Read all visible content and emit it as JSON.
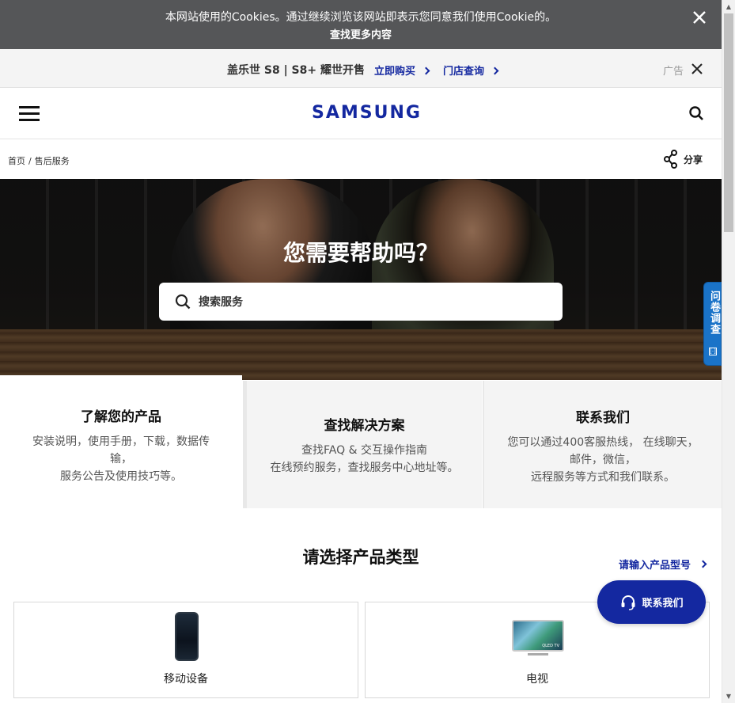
{
  "cookie": {
    "message": "本网站使用的Cookies。通过继续浏览该网站即表示您同意我们使用Cookie的。",
    "more": "查找更多内容"
  },
  "promo": {
    "text": "盖乐世 S8 | S8+ 耀世开售",
    "buy": "立即购买",
    "store": "门店查询",
    "ad": "广告"
  },
  "header": {
    "logo": "SAMSUNG"
  },
  "breadcrumb": {
    "home": "首页",
    "current": "售后服务"
  },
  "share": {
    "label": "分享"
  },
  "hero": {
    "title": "您需要帮助吗？",
    "search_placeholder": "搜索服务"
  },
  "tabs": [
    {
      "title": "了解您的产品",
      "desc": "安装说明，使用手册，下载，数据传输，\n服务公告及使用技巧等。"
    },
    {
      "title": "查找解决方案",
      "desc": "查找FAQ & 交互操作指南\n在线预约服务，查找服务中心地址等。"
    },
    {
      "title": "联系我们",
      "desc": "您可以通过400客服热线， 在线聊天，邮件，微信，\n远程服务等方式和我们联系。"
    }
  ],
  "products": {
    "title": "请选择产品类型",
    "model_link": "请输入产品型号",
    "items": [
      {
        "label": "移动设备",
        "icon": "phone-icon"
      },
      {
        "label": "电视",
        "icon": "tv-icon",
        "badge": "QLED TV"
      }
    ]
  },
  "contact_fab": {
    "label": "联系我们"
  },
  "survey": {
    "label": "问卷调查"
  },
  "colors": {
    "brand": "#1428a0",
    "cookie_bg": "#555658",
    "survey": "#1a73c8"
  }
}
